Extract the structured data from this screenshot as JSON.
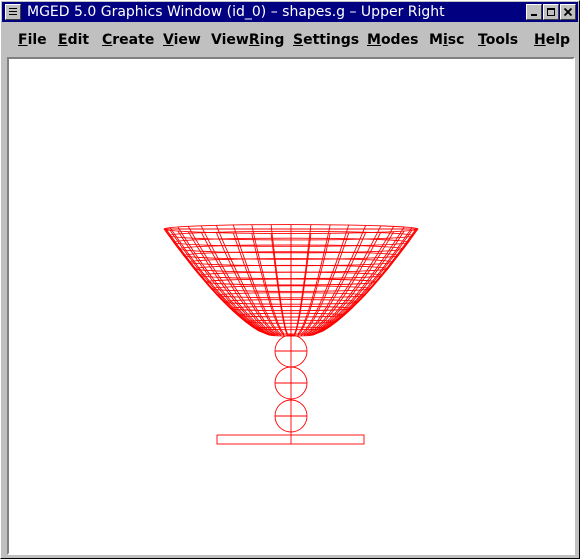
{
  "window": {
    "title": "MGED 5.0 Graphics Window (id_0) – shapes.g – Upper Right"
  },
  "menubar": {
    "items": [
      {
        "label": "File",
        "mnemonic_index": 0
      },
      {
        "label": "Edit",
        "mnemonic_index": 0
      },
      {
        "label": "Create",
        "mnemonic_index": 0
      },
      {
        "label": "View",
        "mnemonic_index": 0
      },
      {
        "label": "ViewRing",
        "mnemonic_index": 4
      },
      {
        "label": "Settings",
        "mnemonic_index": 0
      },
      {
        "label": "Modes",
        "mnemonic_index": 0
      },
      {
        "label": "Misc",
        "mnemonic_index": 1
      },
      {
        "label": "Tools",
        "mnemonic_index": 0
      },
      {
        "label": "Help",
        "mnemonic_index": 0
      }
    ]
  },
  "icons": {
    "system_menu": "window-menu-icon",
    "minimize": "minimize-icon",
    "maximize": "maximize-icon",
    "close": "close-icon"
  },
  "colors": {
    "titlebar": "#000080",
    "wireframe": "#ff0000",
    "canvas_background": "#ffffff"
  }
}
